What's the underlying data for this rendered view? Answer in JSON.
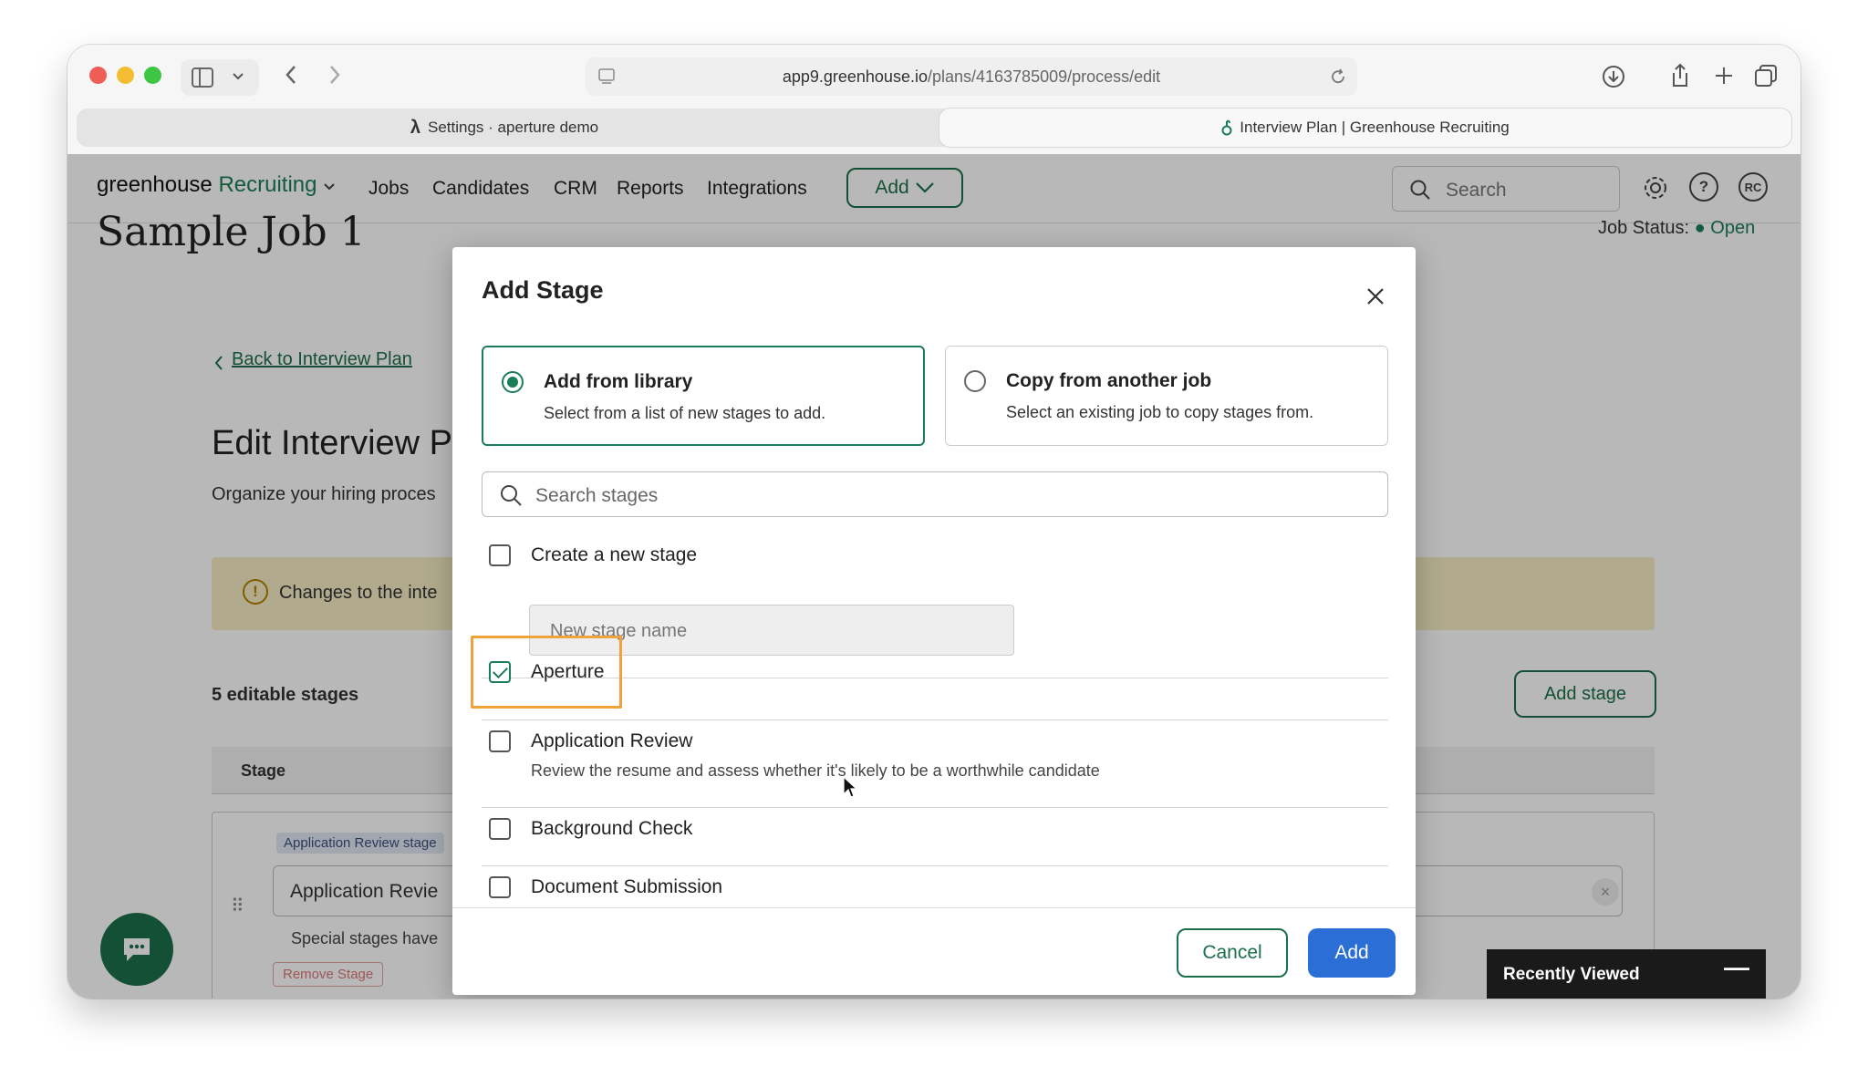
{
  "browser": {
    "url_host": "app9.greenhouse.io",
    "url_path": "/plans/4163785009/process/edit",
    "tabs": [
      {
        "label": "Settings · aperture demo",
        "icon": "lambda-icon",
        "active": false
      },
      {
        "label": "Interview Plan | Greenhouse Recruiting",
        "icon": "greenhouse-icon",
        "active": true
      }
    ]
  },
  "nav": {
    "brand_main": "greenhouse",
    "brand_accent": "Recruiting",
    "items": [
      "Jobs",
      "Candidates",
      "CRM",
      "Reports",
      "Integrations"
    ],
    "add_label": "Add",
    "search_placeholder": "Search",
    "avatar_initials": "RC"
  },
  "page": {
    "job_title": "Sample Job 1",
    "job_status_label": "Job Status:",
    "job_status_value": "Open",
    "back_link": "Back to Interview Plan",
    "edit_title": "Edit Interview P",
    "edit_subtitle": "Organize your hiring proces",
    "banner_text": "Changes to the inte",
    "stages_count": "5 editable stages",
    "add_stage_label": "Add stage",
    "table_header_stage": "Stage",
    "stage_tag": "Application Review stage",
    "stage_input_value": "Application Revie",
    "stage_note": "Special stages have",
    "remove_stage": "Remove Stage"
  },
  "recently_viewed": "Recently Viewed",
  "modal": {
    "title": "Add Stage",
    "options": [
      {
        "title": "Add from library",
        "desc": "Select from a list of new stages to add.",
        "selected": true
      },
      {
        "title": "Copy from another job",
        "desc": "Select an existing job to copy stages from.",
        "selected": false
      }
    ],
    "search_placeholder": "Search stages",
    "create_label": "Create a new stage",
    "new_stage_placeholder": "New stage name",
    "stages": [
      {
        "label": "Aperture",
        "desc": "",
        "checked": true
      },
      {
        "label": "Application Review",
        "desc": "Review the resume and assess whether it's likely to be a worthwhile candidate",
        "checked": false
      },
      {
        "label": "Background Check",
        "desc": "",
        "checked": false
      },
      {
        "label": "Document Submission",
        "desc": "",
        "checked": false
      }
    ],
    "cancel_label": "Cancel",
    "add_label": "Add"
  },
  "colors": {
    "brand_green": "#1b7d57",
    "primary_blue": "#2b6fd6",
    "highlight_orange": "#f2a23a",
    "banner_yellow": "#f5ecc4"
  }
}
